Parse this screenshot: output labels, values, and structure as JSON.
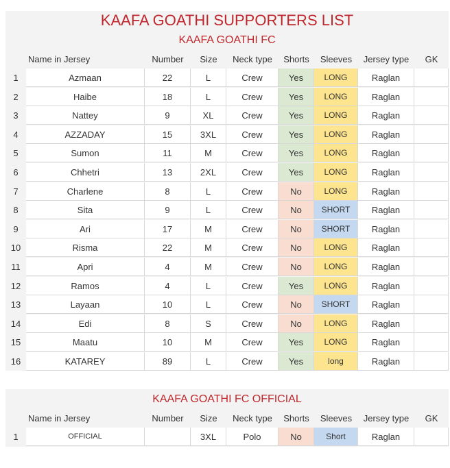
{
  "title": "KAAFA GOATHI SUPPORTERS LIST",
  "columns": [
    "Name in Jersey",
    "Number",
    "Size",
    "Neck type",
    "Shorts",
    "Sleeves",
    "Jersey type",
    "GK"
  ],
  "team1": {
    "subtitle": "KAAFA GOATHI FC",
    "rows": [
      {
        "idx": "1",
        "name": "Azmaan",
        "number": "22",
        "size": "L",
        "neck": "Crew",
        "shorts": "Yes",
        "sleeves": "LONG",
        "jersey": "Raglan",
        "gk": ""
      },
      {
        "idx": "2",
        "name": "Haibe",
        "number": "18",
        "size": "L",
        "neck": "Crew",
        "shorts": "Yes",
        "sleeves": "LONG",
        "jersey": "Raglan",
        "gk": ""
      },
      {
        "idx": "3",
        "name": "Nattey",
        "number": "9",
        "size": "XL",
        "neck": "Crew",
        "shorts": "Yes",
        "sleeves": "LONG",
        "jersey": "Raglan",
        "gk": ""
      },
      {
        "idx": "4",
        "name": "AZZADAY",
        "number": "15",
        "size": "3XL",
        "neck": "Crew",
        "shorts": "Yes",
        "sleeves": "LONG",
        "jersey": "Raglan",
        "gk": ""
      },
      {
        "idx": "5",
        "name": "Sumon",
        "number": "11",
        "size": "M",
        "neck": "Crew",
        "shorts": "Yes",
        "sleeves": "LONG",
        "jersey": "Raglan",
        "gk": ""
      },
      {
        "idx": "6",
        "name": "Chhetri",
        "number": "13",
        "size": "2XL",
        "neck": "Crew",
        "shorts": "Yes",
        "sleeves": "LONG",
        "jersey": "Raglan",
        "gk": ""
      },
      {
        "idx": "7",
        "name": "Charlene",
        "number": "8",
        "size": "L",
        "neck": "Crew",
        "shorts": "No",
        "sleeves": "LONG",
        "jersey": "Raglan",
        "gk": ""
      },
      {
        "idx": "8",
        "name": "Sita",
        "number": "9",
        "size": "L",
        "neck": "Crew",
        "shorts": "No",
        "sleeves": "SHORT",
        "jersey": "Raglan",
        "gk": ""
      },
      {
        "idx": "9",
        "name": "Ari",
        "number": "17",
        "size": "M",
        "neck": "Crew",
        "shorts": "No",
        "sleeves": "SHORT",
        "jersey": "Raglan",
        "gk": ""
      },
      {
        "idx": "10",
        "name": "Risma",
        "number": "22",
        "size": "M",
        "neck": "Crew",
        "shorts": "No",
        "sleeves": "LONG",
        "jersey": "Raglan",
        "gk": ""
      },
      {
        "idx": "11",
        "name": "Apri",
        "number": "4",
        "size": "M",
        "neck": "Crew",
        "shorts": "No",
        "sleeves": "LONG",
        "jersey": "Raglan",
        "gk": ""
      },
      {
        "idx": "12",
        "name": "Ramos",
        "number": "4",
        "size": "L",
        "neck": "Crew",
        "shorts": "Yes",
        "sleeves": "LONG",
        "jersey": "Raglan",
        "gk": ""
      },
      {
        "idx": "13",
        "name": "Layaan",
        "number": "10",
        "size": "L",
        "neck": "Crew",
        "shorts": "No",
        "sleeves": "SHORT",
        "jersey": "Raglan",
        "gk": ""
      },
      {
        "idx": "14",
        "name": "Edi",
        "number": "8",
        "size": "S",
        "neck": "Crew",
        "shorts": "No",
        "sleeves": "LONG",
        "jersey": "Raglan",
        "gk": ""
      },
      {
        "idx": "15",
        "name": "Maatu",
        "number": "10",
        "size": "M",
        "neck": "Crew",
        "shorts": "Yes",
        "sleeves": "LONG",
        "jersey": "Raglan",
        "gk": ""
      },
      {
        "idx": "16",
        "name": "KATAREY",
        "number": "89",
        "size": "L",
        "neck": "Crew",
        "shorts": "Yes",
        "sleeves": "long",
        "jersey": "Raglan",
        "gk": ""
      }
    ]
  },
  "team2": {
    "subtitle": "KAAFA GOATHI FC OFFICIAL",
    "rows": [
      {
        "idx": "1",
        "name": "OFFICIAL",
        "number": "",
        "size": "3XL",
        "neck": "Polo",
        "shorts": "No",
        "sleeves": "Short",
        "jersey": "Raglan",
        "gk": ""
      }
    ]
  },
  "colors": {
    "title": "#c0272d",
    "yes": "#dbe9d2",
    "no": "#f8ddd0",
    "long": "#fde48f",
    "short": "#c4d8f0"
  }
}
